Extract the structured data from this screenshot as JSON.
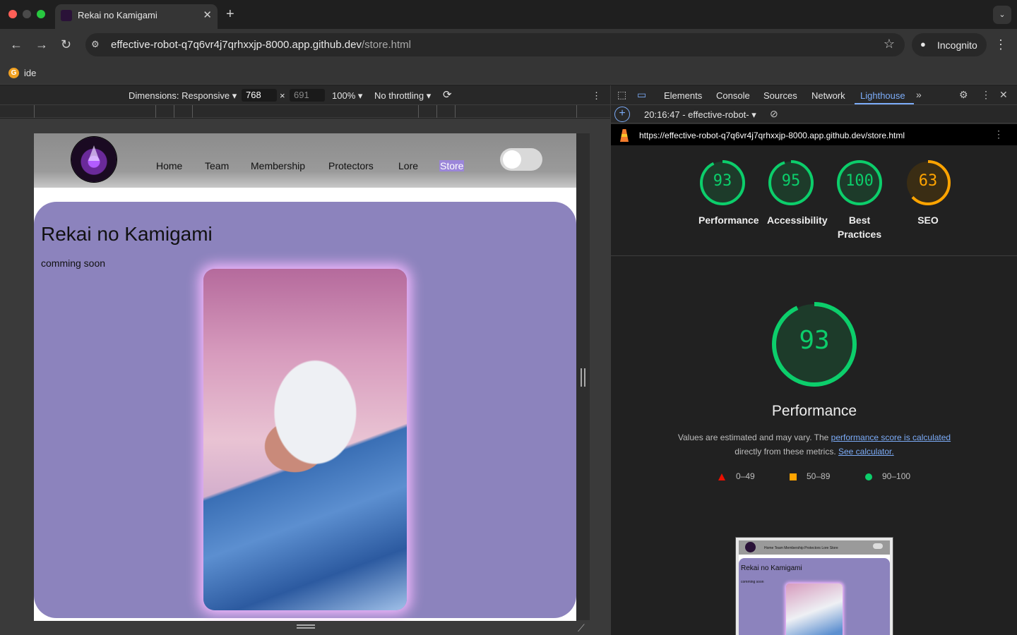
{
  "browser": {
    "tab_title": "Rekai no Kamigami",
    "tab_close": "✕",
    "new_tab": "+",
    "url_host": "effective-robot-q7q6vr4j7qrhxxjp-8000.app.github.dev",
    "url_path": "/store.html",
    "incognito_label": "Incognito",
    "bookmark_label": "ide"
  },
  "device_toolbar": {
    "dimensions_label": "Dimensions: Responsive",
    "width": "768",
    "times": "×",
    "height": "691",
    "zoom": "100%",
    "throttling": "No throttling"
  },
  "site": {
    "nav": [
      "Home",
      "Team",
      "Membership",
      "Protectors",
      "Lore",
      "Store"
    ],
    "active_nav": "Store",
    "title": "Rekai no Kamigami",
    "subtitle": "comming soon"
  },
  "devtools": {
    "tabs": [
      "Elements",
      "Console",
      "Sources",
      "Network",
      "Lighthouse"
    ],
    "active_tab": "Lighthouse",
    "report_label": "20:16:47 - effective-robot-",
    "report_url": "https://effective-robot-q7q6vr4j7qrhxxjp-8000.app.github.dev/store.html"
  },
  "lighthouse": {
    "scores": [
      {
        "label": "Performance",
        "value": 93,
        "color": "#0cce6b"
      },
      {
        "label": "Accessibility",
        "value": 95,
        "color": "#0cce6b"
      },
      {
        "label": "Best Practices",
        "value": 100,
        "color": "#0cce6b"
      },
      {
        "label": "SEO",
        "value": 63,
        "color": "#ffa400"
      }
    ],
    "focus": {
      "label": "Performance",
      "value": 93
    },
    "desc_prefix": "Values are estimated and may vary. The ",
    "desc_link1": "performance score is calculated",
    "desc_mid": "directly from these metrics. ",
    "desc_link2": "See calculator.",
    "legend": [
      {
        "range": "0–49",
        "color": "#eb0f00"
      },
      {
        "range": "50–89",
        "color": "#ffa400"
      },
      {
        "range": "90–100",
        "color": "#0cce6b"
      }
    ]
  },
  "thumbnail": {
    "nav": "Home   Team   Membership   Protectors   Lore   Store",
    "title": "Rekai no Kamigami",
    "subtitle": "comming soon"
  }
}
